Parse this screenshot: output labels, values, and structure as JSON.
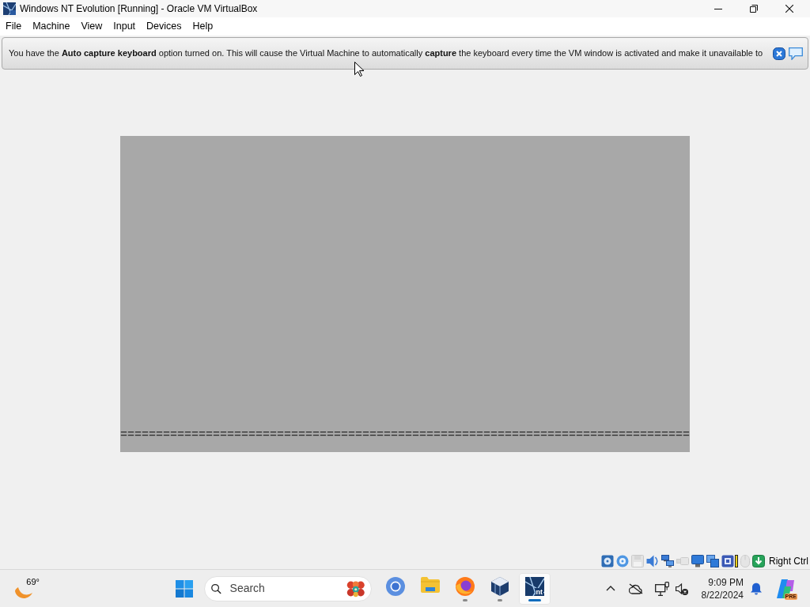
{
  "window": {
    "title": "Windows NT Evolution [Running] - Oracle VM VirtualBox"
  },
  "menu_bar": [
    "File",
    "Machine",
    "View",
    "Input",
    "Devices",
    "Help"
  ],
  "notification": {
    "message": "You have the **Auto capture keyboard** option turned on. This will cause the Virtual Machine to automatically **capture** the keyboard every time the VM window is activated and make it unavailable to"
  },
  "vm_screen": {
    "text": "================================================================================"
  },
  "status_bar": {
    "indicators": [
      {
        "kind": "hard-disk",
        "disabled": false
      },
      {
        "kind": "optical",
        "disabled": false
      },
      {
        "kind": "floppy",
        "disabled": true
      },
      {
        "kind": "audio",
        "disabled": false
      },
      {
        "kind": "network",
        "disabled": false
      },
      {
        "kind": "usb",
        "disabled": true
      },
      {
        "kind": "display",
        "disabled": false
      },
      {
        "kind": "shared-folders",
        "disabled": false
      },
      {
        "kind": "features",
        "disabled": false
      },
      {
        "kind": "mouse",
        "disabled": true
      },
      {
        "kind": "keyboard",
        "disabled": false
      }
    ],
    "host_key": "Right Ctrl"
  },
  "taskbar": {
    "weather": {
      "temperature": "69°"
    },
    "search": {
      "placeholder": "Search"
    },
    "apps": [
      {
        "kind": "browser",
        "running": false,
        "active": false
      },
      {
        "kind": "folder",
        "running": false,
        "active": false
      },
      {
        "kind": "fox",
        "running": true,
        "active": false
      },
      {
        "kind": "cube",
        "running": true,
        "active": false
      },
      {
        "kind": "nt",
        "label": "nt",
        "running": true,
        "active": true
      }
    ],
    "tray": {
      "time": "9:09 PM",
      "date": "8/22/2024",
      "assistant_badge": "PRE"
    }
  }
}
